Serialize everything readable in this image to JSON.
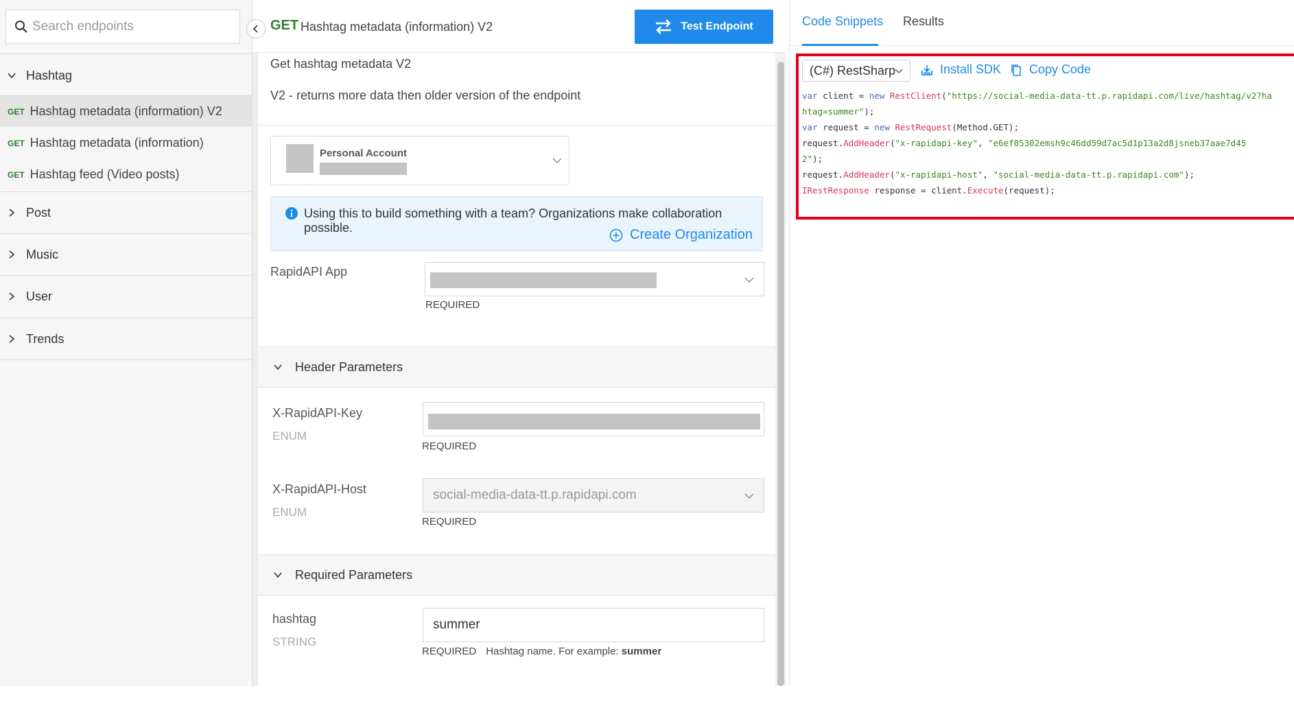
{
  "sidebar": {
    "search_placeholder": "Search endpoints",
    "groups": [
      {
        "label": "Hashtag",
        "expanded": true
      },
      {
        "label": "Post",
        "expanded": false
      },
      {
        "label": "Music",
        "expanded": false
      },
      {
        "label": "User",
        "expanded": false
      },
      {
        "label": "Trends",
        "expanded": false
      }
    ],
    "endpoints": [
      {
        "method": "GET",
        "label": "Hashtag metadata (information) V2",
        "active": true
      },
      {
        "method": "GET",
        "label": "Hashtag metadata (information)",
        "active": false
      },
      {
        "method": "GET",
        "label": "Hashtag feed (Video posts)",
        "active": false
      }
    ]
  },
  "endpoint": {
    "method": "GET",
    "title": "Hashtag metadata (information) V2",
    "test_button": "Test Endpoint",
    "description_title": "Get hashtag metadata V2",
    "description": "V2 - returns more data then older version of the endpoint"
  },
  "account": {
    "label": "Personal Account"
  },
  "org_banner": {
    "message": "Using this to build something with a team? Organizations make collaboration possible.",
    "link": "Create Organization"
  },
  "app_field": {
    "label": "RapidAPI App",
    "required": "REQUIRED"
  },
  "header_params": {
    "title": "Header Parameters",
    "key": {
      "label": "X-RapidAPI-Key",
      "type": "ENUM",
      "required": "REQUIRED"
    },
    "host": {
      "label": "X-RapidAPI-Host",
      "type": "ENUM",
      "value": "social-media-data-tt.p.rapidapi.com",
      "required": "REQUIRED"
    }
  },
  "required_params": {
    "title": "Required Parameters",
    "hashtag": {
      "label": "hashtag",
      "type": "STRING",
      "value": "summer",
      "required": "REQUIRED",
      "hint": "Hashtag name. For example:",
      "example": "summer"
    }
  },
  "right_panel": {
    "tabs": [
      {
        "label": "Code Snippets",
        "active": true
      },
      {
        "label": "Results",
        "active": false
      }
    ],
    "language": "(C#) RestSharp",
    "install_sdk": "Install SDK",
    "copy_code": "Copy Code",
    "code": {
      "l1_var": "var",
      "l1_a": " client = ",
      "l1_new": "new",
      "l1_cls": " RestClient",
      "l1_b": "(",
      "l1_str": "\"https://social-media-data-tt.p.rapidapi.com/live/hashtag/v2?ha",
      "l2_str": "htag=summer\"",
      "l2_b": ");",
      "l3_var": "var",
      "l3_a": " request = ",
      "l3_new": "new",
      "l3_cls": " RestRequest",
      "l3_b": "(Method.GET);",
      "l4_a": "request.",
      "l4_fn": "AddHeader",
      "l4_b": "(",
      "l4_s1": "\"x-rapidapi-key\"",
      "l4_c": ", ",
      "l4_s2": "\"e6ef05302emsh9c46dd59d7ac5d1p13a2d8jsneb37aae7d45",
      "l5_s": "2\"",
      "l5_b": ");",
      "l6_a": "request.",
      "l6_fn": "AddHeader",
      "l6_b": "(",
      "l6_s1": "\"x-rapidapi-host\"",
      "l6_c": ", ",
      "l6_s2": "\"social-media-data-tt.p.rapidapi.com\"",
      "l6_d": ");",
      "l7_cls": "IRestResponse",
      "l7_a": " response = client.",
      "l7_fn": "Execute",
      "l7_b": "(request);"
    }
  },
  "colors": {
    "accent": "#1f8ae9",
    "get_method": "#2e7d32",
    "highlight_border": "#e0001b"
  }
}
